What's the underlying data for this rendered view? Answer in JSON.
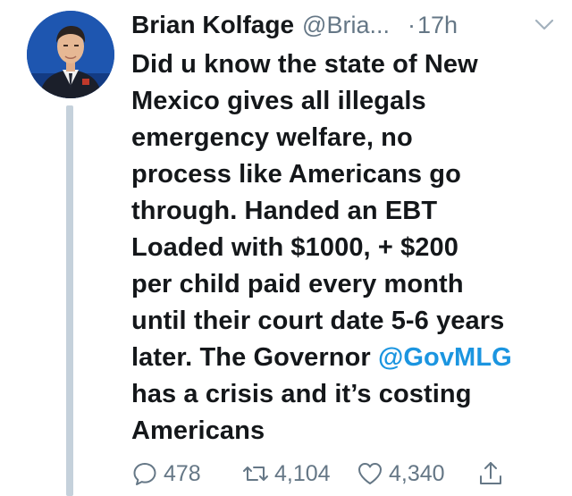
{
  "tweet": {
    "author_name": "Brian Kolfage",
    "author_handle": "@Bria...",
    "separator": "·",
    "timestamp": "17h",
    "text_lines": [
      "Did u know the state of New",
      "Mexico gives all illegals",
      "emergency welfare, no",
      "process like Americans go",
      "through. Handed an EBT",
      "Loaded with $1000, + $200",
      "per child paid every month",
      "until their court date 5-6 years",
      "later. The Governor ",
      "has a crisis and it’s costing",
      "Americans"
    ],
    "mention": "@GovMLG"
  },
  "actions": {
    "reply_count": "478",
    "retweet_count": "4,104",
    "like_count": "4,340"
  },
  "icons": {
    "reply": "reply-icon",
    "retweet": "retweet-icon",
    "like": "heart-icon",
    "share": "share-icon",
    "menu": "chevron-down-icon"
  },
  "colors": {
    "text": "#14171a",
    "secondary": "#657786",
    "link": "#1b95e0",
    "thread_line": "#c5d1db"
  }
}
